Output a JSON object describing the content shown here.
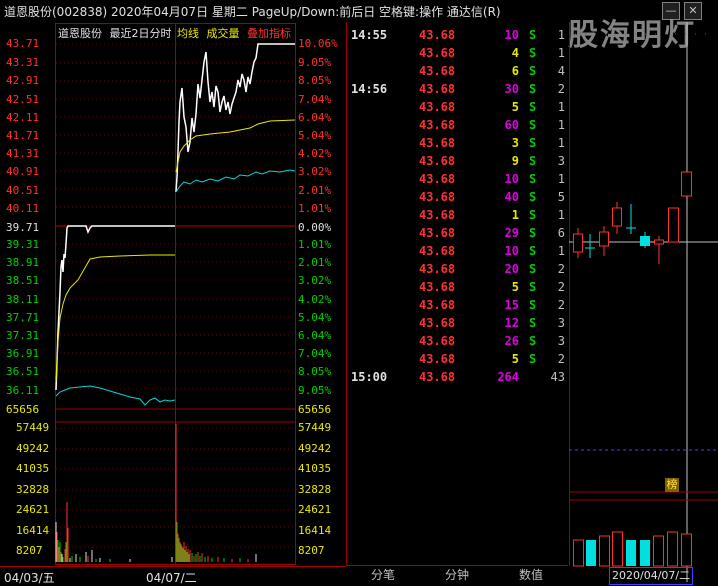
{
  "window": {
    "title": "道恩股份(002838)  2020年04月07日  星期二  PageUp/Down:前后日  空格键:操作  通达信(R)",
    "watermark": "股海明灯",
    "min_btn": "—",
    "close_btn": "✕"
  },
  "chart_header": {
    "name": "道恩股份",
    "mode": "最近2日分时",
    "avg_label": "均线",
    "vol_label": "成交量",
    "overlay_label": "叠加指标",
    "colors": {
      "avg": "#e8e800",
      "vol": "#e8e800",
      "overlay": "#ff3030"
    }
  },
  "price_axis": {
    "day2": {
      "left": [
        "43.71",
        "43.31",
        "42.91",
        "42.51",
        "42.11",
        "41.71",
        "41.31",
        "40.91",
        "40.51",
        "40.11"
      ],
      "right": [
        "10.06%",
        "9.05%",
        "8.05%",
        "7.04%",
        "6.04%",
        "5.04%",
        "4.02%",
        "3.02%",
        "2.01%",
        "1.01%"
      ]
    },
    "ref": {
      "left": "39.71",
      "right": "0.00%"
    },
    "day1": {
      "left": [
        "39.31",
        "38.91",
        "38.51",
        "38.11",
        "37.71",
        "37.31",
        "36.91",
        "36.51",
        "36.11"
      ],
      "right": [
        "1.01%",
        "2.01%",
        "3.02%",
        "4.02%",
        "5.04%",
        "6.04%",
        "7.04%",
        "8.05%",
        "9.05%"
      ]
    },
    "vol_top": {
      "left": "65656",
      "right": "65656"
    }
  },
  "volume_axis": {
    "left": [
      "57449",
      "49242",
      "41035",
      "32828",
      "24621",
      "16414",
      "8207"
    ],
    "right": [
      "57449",
      "49242",
      "41035",
      "32828",
      "24621",
      "16414",
      "8207"
    ]
  },
  "dates": {
    "day1": "04/03/五",
    "day2": "04/07/二"
  },
  "ticks": {
    "groups": [
      {
        "time": "14:55",
        "rows": [
          {
            "price": "43.68",
            "vol": "10",
            "vcolor": "mag",
            "side": "S",
            "n": "1"
          },
          {
            "price": "43.68",
            "vol": "4",
            "vcolor": "yel",
            "side": "S",
            "n": "1"
          },
          {
            "price": "43.68",
            "vol": "6",
            "vcolor": "yel",
            "side": "S",
            "n": "4"
          }
        ]
      },
      {
        "time": "14:56",
        "rows": [
          {
            "price": "43.68",
            "vol": "30",
            "vcolor": "mag",
            "side": "S",
            "n": "2"
          },
          {
            "price": "43.68",
            "vol": "5",
            "vcolor": "yel",
            "side": "S",
            "n": "1"
          },
          {
            "price": "43.68",
            "vol": "60",
            "vcolor": "mag",
            "side": "S",
            "n": "1"
          },
          {
            "price": "43.68",
            "vol": "3",
            "vcolor": "yel",
            "side": "S",
            "n": "1"
          },
          {
            "price": "43.68",
            "vol": "9",
            "vcolor": "yel",
            "side": "S",
            "n": "3"
          },
          {
            "price": "43.68",
            "vol": "10",
            "vcolor": "mag",
            "side": "S",
            "n": "1"
          },
          {
            "price": "43.68",
            "vol": "40",
            "vcolor": "mag",
            "side": "S",
            "n": "5"
          },
          {
            "price": "43.68",
            "vol": "1",
            "vcolor": "yel",
            "side": "S",
            "n": "1"
          },
          {
            "price": "43.68",
            "vol": "29",
            "vcolor": "mag",
            "side": "S",
            "n": "6"
          },
          {
            "price": "43.68",
            "vol": "10",
            "vcolor": "mag",
            "side": "S",
            "n": "1"
          },
          {
            "price": "43.68",
            "vol": "20",
            "vcolor": "mag",
            "side": "S",
            "n": "2"
          },
          {
            "price": "43.68",
            "vol": "5",
            "vcolor": "yel",
            "side": "S",
            "n": "2"
          },
          {
            "price": "43.68",
            "vol": "15",
            "vcolor": "mag",
            "side": "S",
            "n": "2"
          },
          {
            "price": "43.68",
            "vol": "12",
            "vcolor": "mag",
            "side": "S",
            "n": "3"
          },
          {
            "price": "43.68",
            "vol": "26",
            "vcolor": "mag",
            "side": "S",
            "n": "3"
          },
          {
            "price": "43.68",
            "vol": "5",
            "vcolor": "yel",
            "side": "S",
            "n": "2"
          }
        ]
      },
      {
        "time": "15:00",
        "rows": [
          {
            "price": "43.68",
            "vol": "264",
            "vcolor": "mag",
            "side": "",
            "n": "43"
          }
        ]
      }
    ]
  },
  "tabs": {
    "ticks": "分笔",
    "minute": "分钟",
    "data": "数值"
  },
  "kline": {
    "date": "2020/04/07/二",
    "badge": "榜"
  }
}
